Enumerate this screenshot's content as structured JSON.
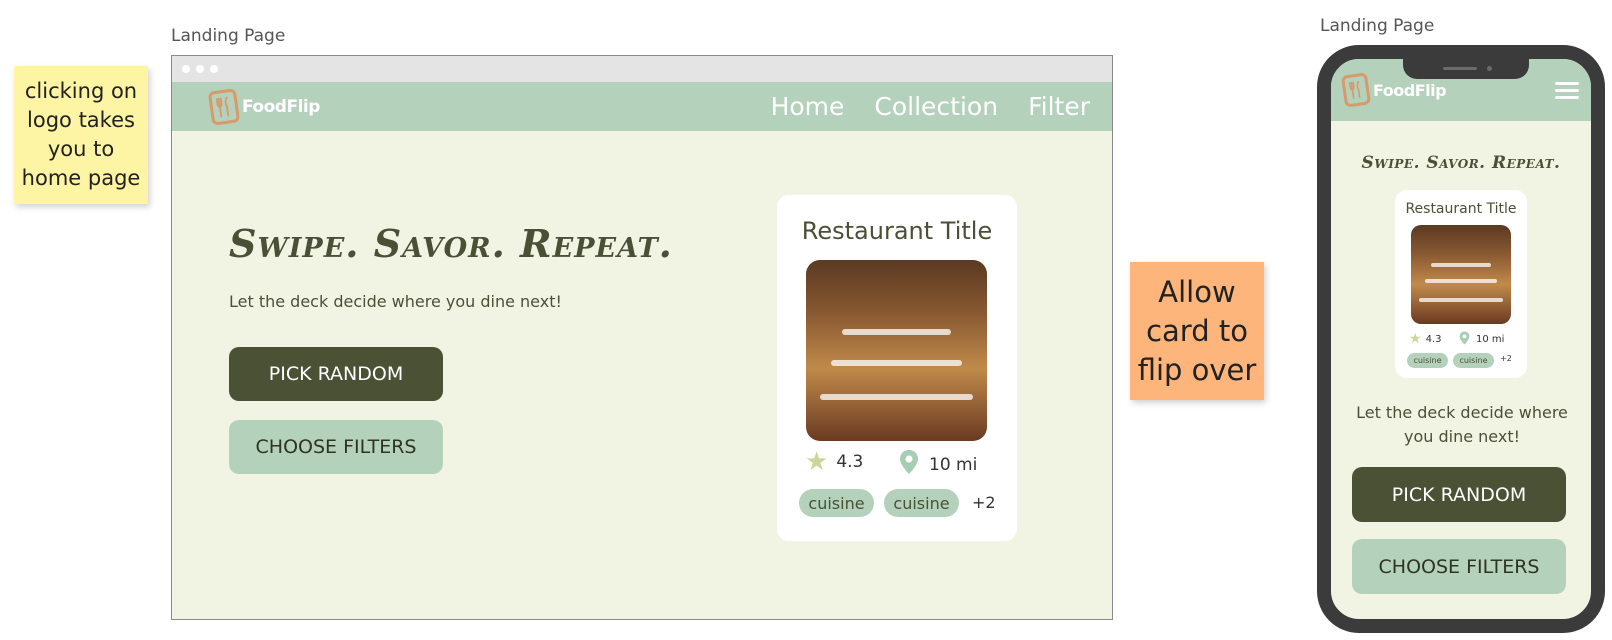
{
  "annotations": {
    "desktop_label": "Landing Page",
    "mobile_label": "Landing Page",
    "sticky_logo_note": "clicking on logo takes you to home page",
    "sticky_flip_note": "Allow card to flip over"
  },
  "desktop": {
    "logo_text": "FoodFlip",
    "nav": [
      "Home",
      "Collection",
      "Filter"
    ],
    "hero_title": "Swipe. Savor. Repeat.",
    "hero_subtitle": "Let the deck decide where you dine next!",
    "pick_random_label": "PICK RANDOM",
    "choose_filters_label": "CHOOSE FILTERS",
    "card": {
      "title": "Restaurant Title",
      "rating": "4.3",
      "distance": "10 mi",
      "tags": [
        "cuisine",
        "cuisine"
      ],
      "more": "+2"
    }
  },
  "mobile": {
    "logo_text": "FoodFlip",
    "hero_title": "Swipe. Savor. Repeat.",
    "hero_subtitle": "Let the deck decide where you dine next!",
    "pick_random_label": "PICK RANDOM",
    "choose_filters_label": "CHOOSE FILTERS",
    "card": {
      "title": "Restaurant Title",
      "rating": "4.3",
      "distance": "10 mi",
      "tags": [
        "cuisine",
        "cuisine"
      ],
      "more": "+2"
    }
  },
  "icons": {
    "logo": "fork-knife-icon",
    "rating": "star-icon",
    "distance": "map-pin-icon",
    "menu": "hamburger-menu-icon"
  },
  "colors": {
    "nav": "#b4d1bb",
    "background": "#f2f4e3",
    "primary_button": "#4b5135",
    "secondary_button": "#b4d1bb",
    "logo_accent": "#d89a6a"
  }
}
